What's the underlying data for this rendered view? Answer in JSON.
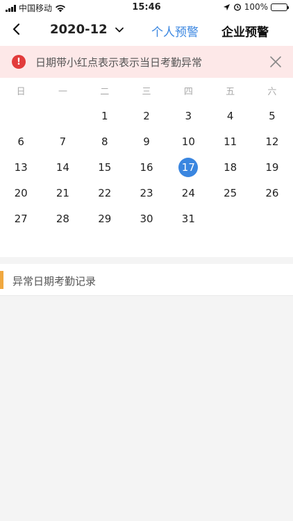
{
  "status_bar": {
    "carrier": "中国移动",
    "time": "15:46",
    "battery": "100%"
  },
  "nav": {
    "month": "2020-12",
    "tab_personal": "个人预警",
    "tab_enterprise": "企业预警"
  },
  "alert": {
    "text": "日期带小红点表示表示当日考勤异常"
  },
  "calendar": {
    "weekdays": [
      "日",
      "一",
      "二",
      "三",
      "四",
      "五",
      "六"
    ],
    "days": [
      "",
      "",
      "1",
      "2",
      "3",
      "4",
      "5",
      "6",
      "7",
      "8",
      "9",
      "10",
      "11",
      "12",
      "13",
      "14",
      "15",
      "16",
      "17",
      "18",
      "19",
      "20",
      "21",
      "22",
      "23",
      "24",
      "25",
      "26",
      "27",
      "28",
      "29",
      "30",
      "31",
      "",
      ""
    ],
    "selected_day": "17"
  },
  "records": {
    "title": "异常日期考勤记录"
  },
  "colors": {
    "accent": "#3a86e0",
    "alert_bg": "#fde8e8",
    "alert_icon": "#e23b3b",
    "record_bar": "#f0a840"
  }
}
